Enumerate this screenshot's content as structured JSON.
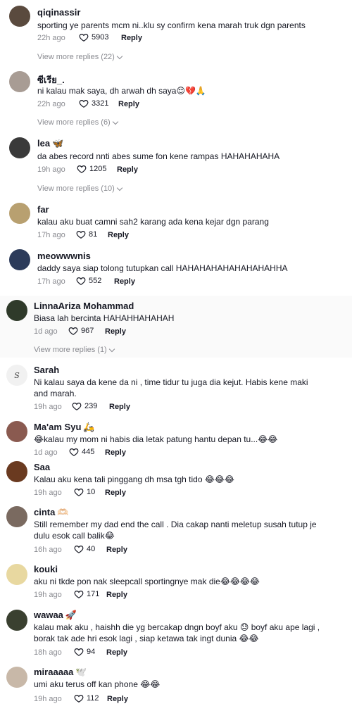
{
  "comments": [
    {
      "user": "qiqinassir",
      "user_emoji": "",
      "text": "sporting ye parents mcm ni..klu sy confirm kena marah truk dgn parents",
      "time": "22h ago",
      "likes": "5903",
      "reply_label": "Reply",
      "more_replies": "View more replies (22)",
      "avatar_color": "#5a4a3e"
    },
    {
      "user": "ซีเรีย_.",
      "user_emoji": "",
      "text": "ni kalau mak saya, dh arwah dh saya😌💔🙏",
      "time": "22h ago",
      "likes": "3321",
      "reply_label": "Reply",
      "more_replies": "View more replies (6)",
      "avatar_color": "#a89c94"
    },
    {
      "user": "lea",
      "user_emoji": "🦋",
      "text": "da abes record nnti abes sume fon kene rampas HAHAHAHAHA",
      "time": "19h ago",
      "likes": "1205",
      "reply_label": "Reply",
      "more_replies": "View more replies (10)",
      "avatar_color": "#3a3a3a"
    },
    {
      "user": "far",
      "user_emoji": "",
      "text": "kalau aku buat camni sah2 karang ada kena kejar dgn parang",
      "time": "17h ago",
      "likes": "81",
      "reply_label": "Reply",
      "more_replies": "",
      "avatar_color": "#b8a070"
    },
    {
      "user": "meowwwnis",
      "user_emoji": "",
      "text": "daddy saya siap tolong tutupkan call HAHAHAHAHAHAHAHAHHA",
      "time": "17h ago",
      "likes": "552",
      "reply_label": "Reply",
      "more_replies": "",
      "avatar_color": "#2c3b5a"
    },
    {
      "user": "LinnaAriza Mohammad",
      "user_emoji": "",
      "text": "Biasa lah bercinta HAHAHHAHAHAH",
      "time": "1d ago",
      "likes": "967",
      "reply_label": "Reply",
      "more_replies": "View more replies (1)",
      "avatar_color": "#2f3a2a"
    },
    {
      "user": "Sarah",
      "user_emoji": "",
      "text": "Ni kalau saya da kene da ni , time tidur tu juga dia kejut. Habis kene maki and marah.",
      "time": "19h ago",
      "likes": "239",
      "reply_label": "Reply",
      "more_replies": "",
      "avatar_color": "#f1f1f1"
    },
    {
      "user": "Ma'am Syu",
      "user_emoji": "🛵",
      "text": "😂kalau my mom ni habis dia letak patung hantu depan tu...😂😂",
      "time": "1d ago",
      "likes": "445",
      "reply_label": "Reply",
      "more_replies": "",
      "avatar_color": "#8a5a50"
    },
    {
      "user": "Saa",
      "user_emoji": "",
      "text": "Kalau aku kena tali pinggang dh msa tgh tido 😂😂😂",
      "time": "19h ago",
      "likes": "10",
      "reply_label": "Reply",
      "more_replies": "",
      "avatar_color": "#6a3a20"
    },
    {
      "user": "cinta",
      "user_emoji": "🫶🏻",
      "text": "Still remember my dad end the call . Dia cakap nanti meletup susah tutup je dulu esok call balik😂",
      "time": "16h ago",
      "likes": "40",
      "reply_label": "Reply",
      "more_replies": "",
      "avatar_color": "#7a6a60"
    },
    {
      "user": "kouki",
      "user_emoji": "",
      "text": "aku ni tkde pon nak sleepcall sportingnye mak die😂😂😂😂",
      "time": "19h ago",
      "likes": "171",
      "reply_label": "Reply",
      "more_replies": "",
      "avatar_color": "#e8d8a0"
    },
    {
      "user": "wawaa",
      "user_emoji": "🚀",
      "text": "kalau mak aku , haishh die yg bercakap dngn boyf aku 😓 boyf aku ape lagi , borak tak ade hri esok lagi , siap ketawa tak ingt dunia 😂😂",
      "time": "18h ago",
      "likes": "94",
      "reply_label": "Reply",
      "more_replies": "",
      "avatar_color": "#3a4030"
    },
    {
      "user": "miraaaaa",
      "user_emoji": "🕊️",
      "text": "umi aku terus off kan phone 😂😂",
      "time": "19h ago",
      "likes": "112",
      "reply_label": "Reply",
      "more_replies": "",
      "avatar_color": "#c8b8a8"
    }
  ]
}
